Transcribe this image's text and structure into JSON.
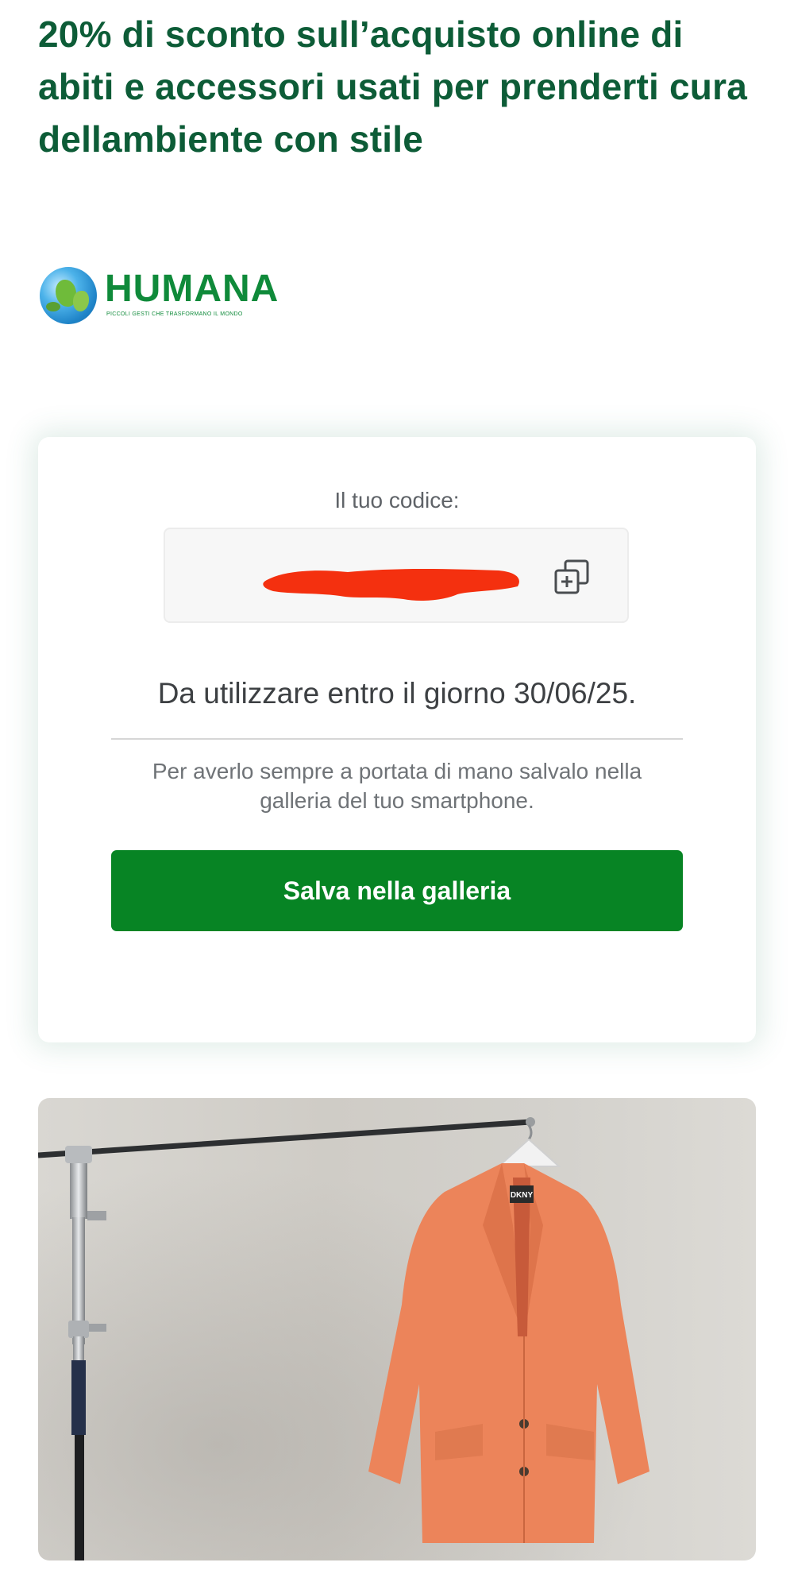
{
  "offer": {
    "headline": "20% di sconto sull’acquisto online di abiti e accessori usati per prenderti cura dellambiente con stile"
  },
  "brand": {
    "name": "HUMANA",
    "tagline": "PICCOLI GESTI CHE TRASFORMANO IL MONDO"
  },
  "coupon": {
    "label": "Il tuo codice:",
    "code": "",
    "expiry_text": "Da utilizzare entro il giorno 30/06/25.",
    "save_hint": "Per averlo sempre a portata di mano salvalo nella galleria del tuo smartphone.",
    "save_button_label": "Salva nella galleria",
    "copy_icon": "copy-icon"
  },
  "colors": {
    "headline": "#0d5c37",
    "brand_green": "#0f8a3a",
    "button": "#078424",
    "redaction": "#f4300f",
    "jacket": "#ec845a"
  },
  "product_image": {
    "label_text": "DKNY"
  }
}
